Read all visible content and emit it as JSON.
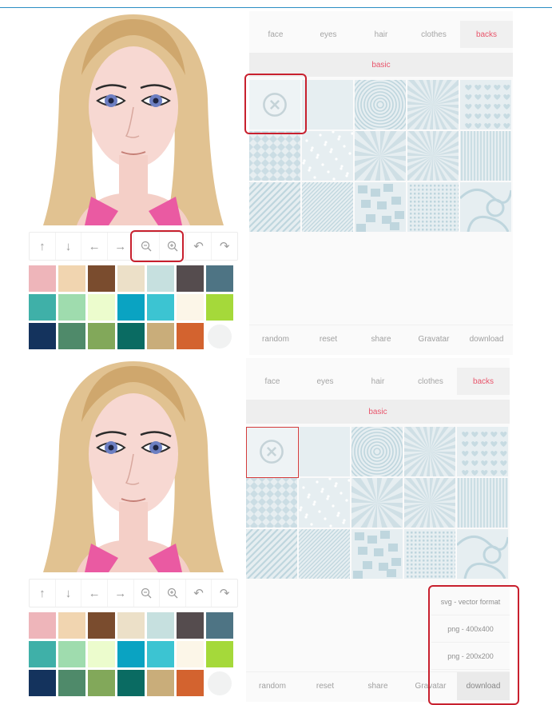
{
  "colors": {
    "accent": "#e8566c",
    "highlight": "#c8202e",
    "pattern_line": "#bfd6de",
    "pattern_bg": "#e6eef1"
  },
  "tabs": [
    "face",
    "eyes",
    "hair",
    "clothes",
    "backs"
  ],
  "active_tab": "backs",
  "subtab": "basic",
  "toolbar_icons": [
    "arrow-up-icon",
    "arrow-down-icon",
    "arrow-left-icon",
    "arrow-right-icon",
    "zoom-out-icon",
    "zoom-in-icon",
    "undo-icon",
    "redo-icon"
  ],
  "toolbar_glyphs": [
    "↑",
    "↓",
    "←",
    "→",
    "",
    "",
    "↶",
    "↷"
  ],
  "swatches": [
    "#eeb5ba",
    "#f1d5b0",
    "#7a4c2e",
    "#ece0c8",
    "#c6e0df",
    "#554c4e",
    "#4e7484",
    "#3fb0a8",
    "#9fdcae",
    "#ecfccd",
    "#0aa3c2",
    "#3cc4d2",
    "#fcf6e8",
    "#a5d93a",
    "#14335d",
    "#4f8a6a",
    "#82a85a",
    "#0a6b62",
    "#c9ad7a",
    "#d3632f",
    ""
  ],
  "patterns": [
    "none",
    "plain",
    "circles",
    "sunburst",
    "hearts",
    "diamonds",
    "dots",
    "rays",
    "starburst",
    "stripes-v",
    "diagonal-wide",
    "diagonal-thin",
    "squares",
    "grid-dots",
    "curves"
  ],
  "bottom_buttons": [
    "random",
    "reset",
    "share",
    "Gravatar",
    "download"
  ],
  "download_menu": [
    "svg - vector format",
    "png - 400x400",
    "png - 200x200"
  ]
}
